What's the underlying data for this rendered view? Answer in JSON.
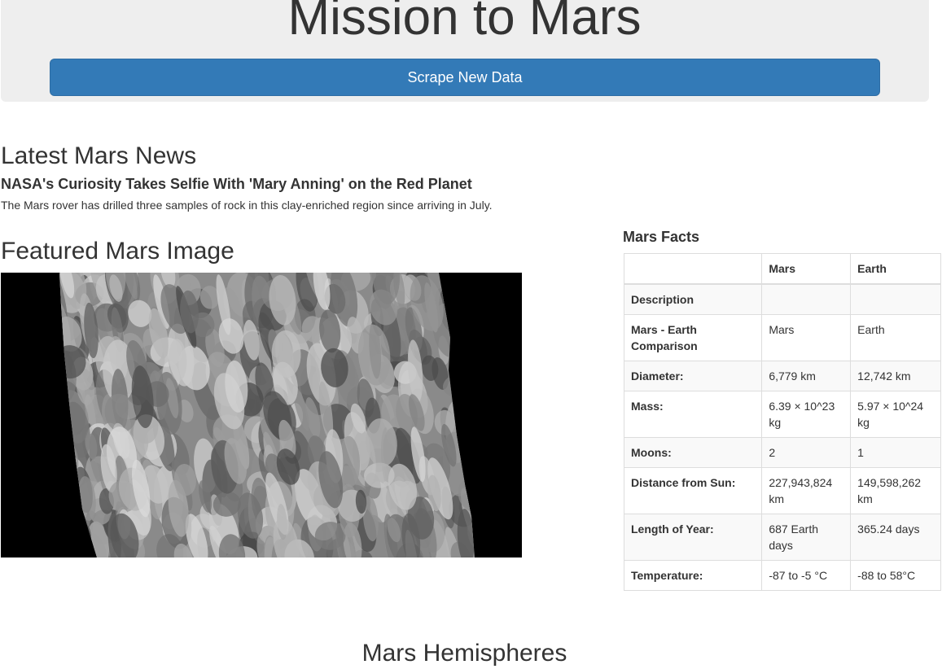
{
  "header": {
    "title": "Mission to Mars",
    "scrape_button": "Scrape New Data"
  },
  "news": {
    "heading": "Latest Mars News",
    "title": "NASA's Curiosity Takes Selfie With 'Mary Anning' on the Red Planet",
    "paragraph": "The Mars rover has drilled three samples of rock in this clay-enriched region since arriving in July."
  },
  "featured": {
    "heading": "Featured Mars Image"
  },
  "facts": {
    "heading": "Mars Facts",
    "columns": [
      "",
      "Mars",
      "Earth"
    ],
    "rows": [
      {
        "label": "Description",
        "mars": "",
        "earth": ""
      },
      {
        "label": "Mars - Earth Comparison",
        "mars": "Mars",
        "earth": "Earth"
      },
      {
        "label": "Diameter:",
        "mars": "6,779 km",
        "earth": "12,742 km"
      },
      {
        "label": "Mass:",
        "mars": "6.39 × 10^23 kg",
        "earth": "5.97 × 10^24 kg"
      },
      {
        "label": "Moons:",
        "mars": "2",
        "earth": "1"
      },
      {
        "label": "Distance from Sun:",
        "mars": "227,943,824 km",
        "earth": "149,598,262 km"
      },
      {
        "label": "Length of Year:",
        "mars": "687 Earth days",
        "earth": "365.24 days"
      },
      {
        "label": "Temperature:",
        "mars": "-87 to -5 °C",
        "earth": "-88 to 58°C"
      }
    ]
  },
  "hemispheres": {
    "heading": "Mars Hemispheres"
  }
}
